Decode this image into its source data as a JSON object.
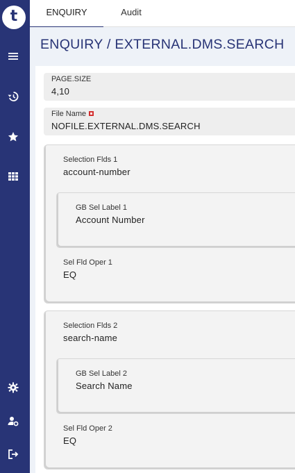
{
  "sidebar": {
    "logo": "t",
    "icons": [
      "menu-icon",
      "history-icon",
      "star-icon",
      "grid-icon",
      "settings-icon",
      "user-settings-icon",
      "logout-icon"
    ]
  },
  "tabs": [
    {
      "label": "ENQUIRY",
      "active": true
    },
    {
      "label": "Audit",
      "active": false
    }
  ],
  "page": {
    "title": "ENQUIRY / EXTERNAL.DMS.SEARCH"
  },
  "fields": {
    "page_size": {
      "label": "PAGE.SIZE",
      "value": "4,10"
    },
    "file_name": {
      "label": "File Name",
      "value": "NOFILE.EXTERNAL.DMS.SEARCH"
    }
  },
  "groups": [
    {
      "selection_label": "Selection Flds 1",
      "selection_value": "account-number",
      "gb_label": "GB Sel Label 1",
      "gb_value": "Account Number",
      "oper_label": "Sel Fld Oper 1",
      "oper_value": "EQ"
    },
    {
      "selection_label": "Selection Flds 2",
      "selection_value": "search-name",
      "gb_label": "GB Sel Label 2",
      "gb_value": "Search Name",
      "oper_label": "Sel Fld Oper 2",
      "oper_value": "EQ"
    }
  ],
  "colors": {
    "sidebar": "#283476",
    "accent": "#283476",
    "field_bg": "#eeeeee",
    "flag": "#d32f2f"
  }
}
